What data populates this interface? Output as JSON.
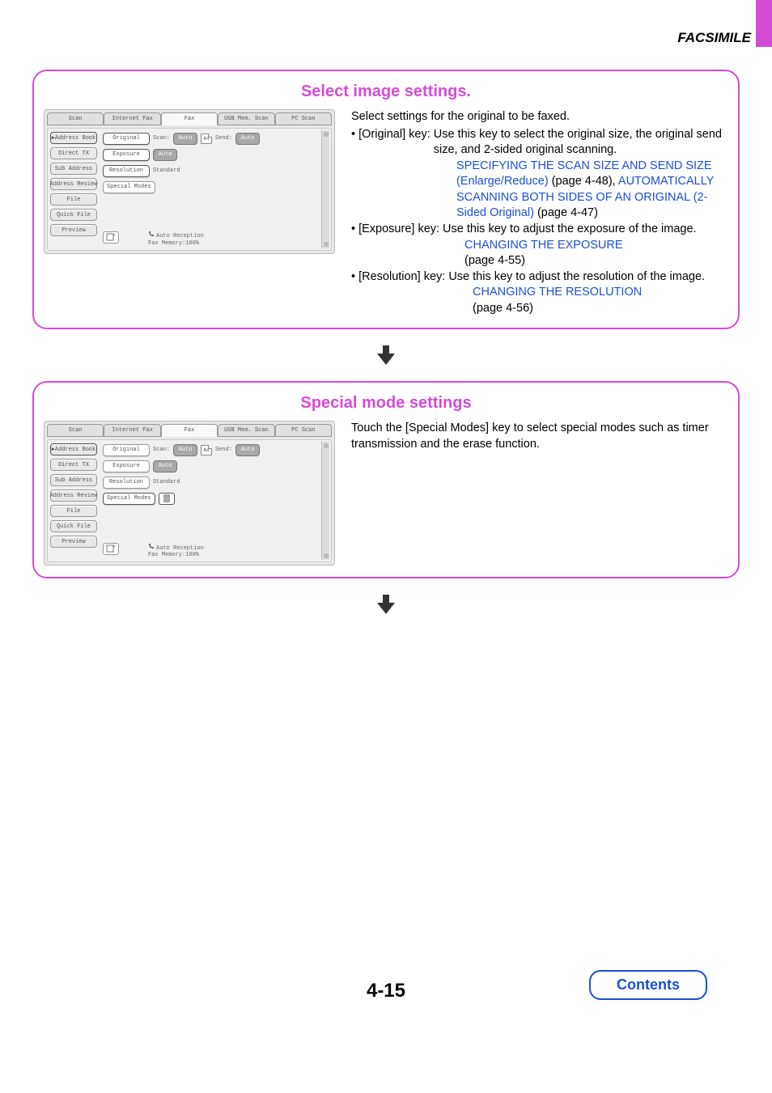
{
  "header": {
    "title": "FACSIMILE"
  },
  "page_number": "4-15",
  "contents_button": "Contents",
  "card1": {
    "title": "Select image settings.",
    "text": {
      "intro": "Select settings for the original to be faxed.",
      "original_key": "• [Original] key:",
      "original_desc1": "Use this key to select the original size, the original send size, and 2-sided original scanning.",
      "original_link1": "SPECIFYING THE SCAN SIZE AND SEND SIZE (Enlarge/Reduce)",
      "original_pg1": " (page 4-48), ",
      "original_link2": "AUTOMATICALLY SCANNING BOTH SIDES OF AN ORIGINAL (2-Sided Original)",
      "original_pg2": " (page 4-47)",
      "exposure_key": "• [Exposure] key:",
      "exposure_desc": "Use this key to adjust the exposure of the image.",
      "exposure_link": "CHANGING THE EXPOSURE",
      "exposure_pg": "(page 4-55)",
      "resolution_key": "• [Resolution] key:",
      "resolution_desc": "Use this key to adjust the resolution of the image.",
      "resolution_link": "CHANGING THE RESOLUTION",
      "resolution_pg": "(page 4-56)"
    }
  },
  "card2": {
    "title": "Special mode settings",
    "text": "Touch the [Special Modes] key to select special modes such as timer transmission and the erase function."
  },
  "panel": {
    "tabs": {
      "scan": "Scan",
      "ifax": "Internet Fax",
      "fax": "Fax",
      "usb": "USB Mem. Scan",
      "pc": "PC Scan"
    },
    "side": {
      "address_book": "Address Book",
      "direct_tx": "Direct TX",
      "sub_address": "Sub Address",
      "address_review": "Address Review",
      "file": "File",
      "quick_file": "Quick File",
      "preview": "Preview"
    },
    "area": {
      "original": "Original",
      "scan_label": "Scan:",
      "auto": "Auto",
      "a4": "A4",
      "send_label": "Send:",
      "exposure": "Exposure",
      "resolution": "Resolution",
      "standard": "Standard",
      "special_modes": "Special Modes",
      "status1": "Auto Reception",
      "status2": "Fax Memory:100%"
    }
  }
}
